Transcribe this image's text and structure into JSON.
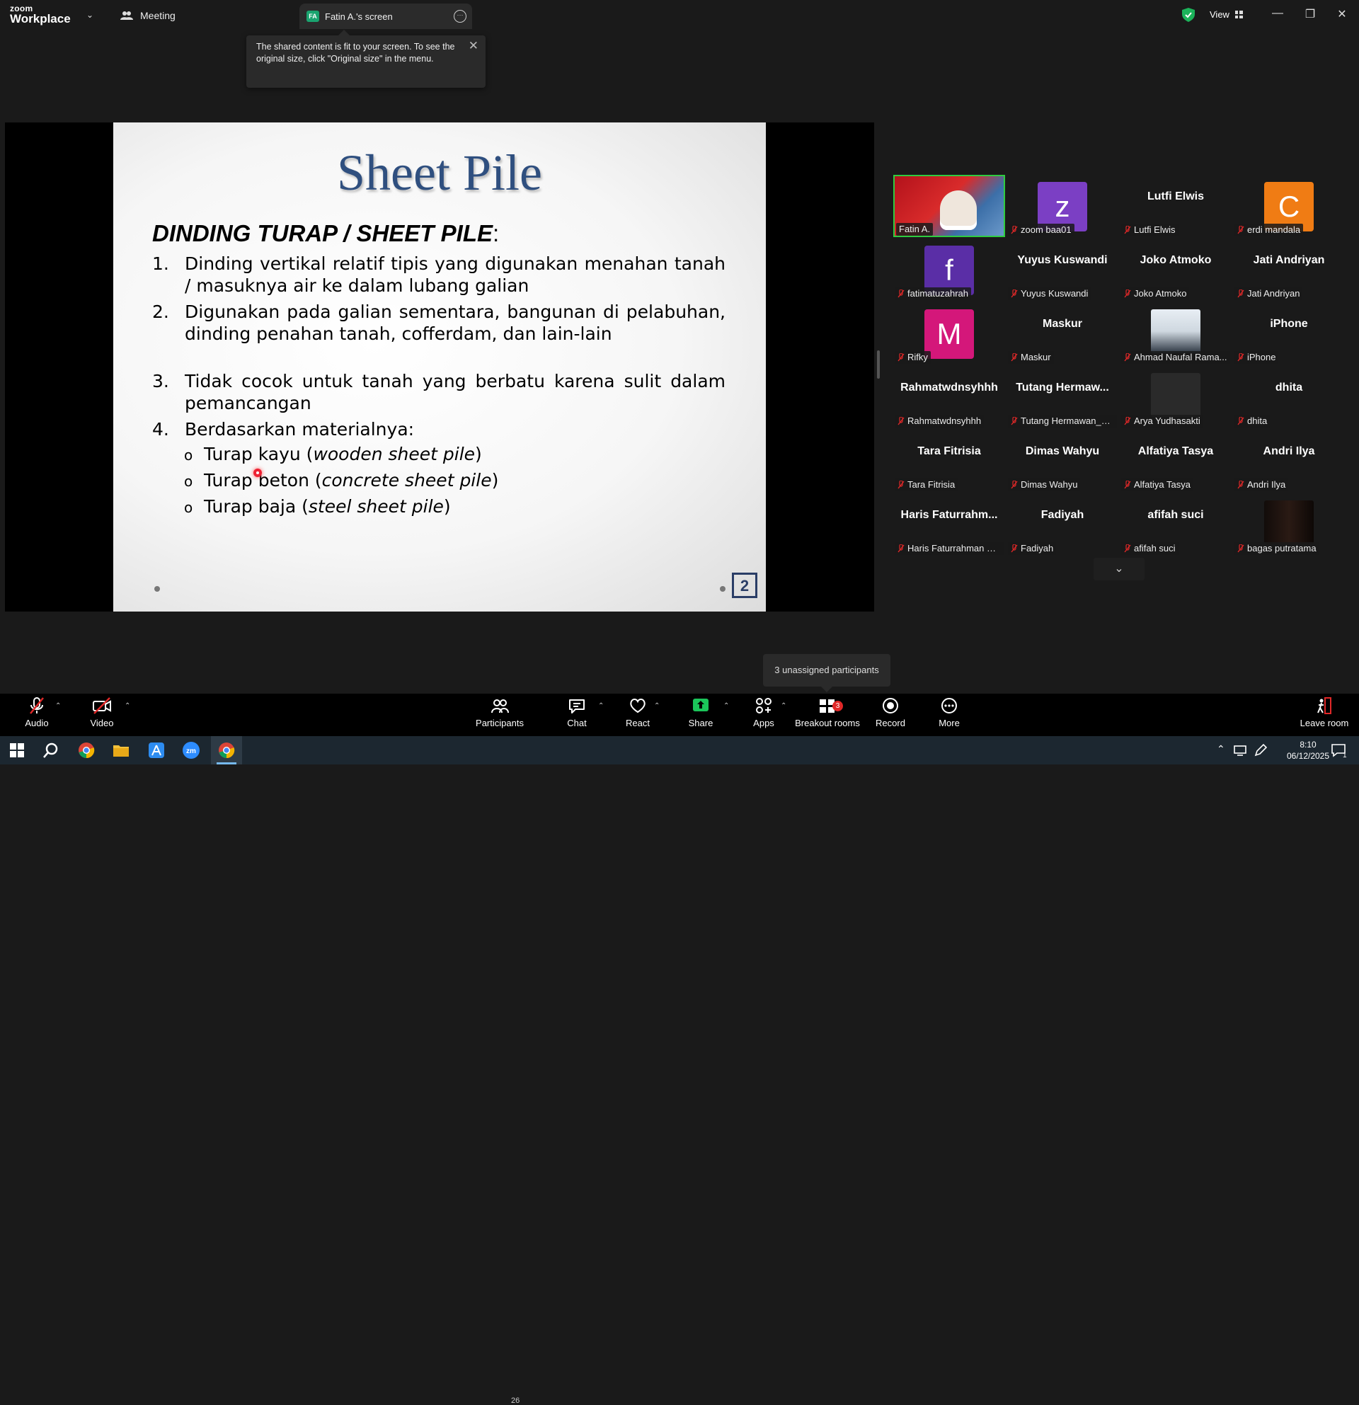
{
  "titlebar": {
    "logo_top": "zoom",
    "logo_bottom": "Workplace",
    "meeting_label": "Meeting",
    "tab_badge": "FA",
    "tab_label": "Fatin A.'s screen",
    "view_label": "View"
  },
  "tooltip": {
    "text": "The shared content is fit to your screen. To see the original size, click \"Original size\" in the menu."
  },
  "slide": {
    "title": "Sheet Pile",
    "heading": "DINDING TURAP / SHEET PILE",
    "heading_colon": ":",
    "points": [
      {
        "num": "1.",
        "text": "Dinding vertikal relatif tipis yang digunakan menahan tanah / masuknya air ke dalam  lubang galian"
      },
      {
        "num": "2.",
        "text": "Digunakan pada galian sementara, bangunan di pelabuhan, dinding penahan tanah, cofferdam, dan lain-lain"
      },
      {
        "num": "3.",
        "text": "Tidak cocok untuk tanah yang berbatu karena sulit dalam pemancangan"
      },
      {
        "num": "4.",
        "text": "Berdasarkan materialnya:"
      }
    ],
    "subpoints": [
      {
        "bullet": "o",
        "text": "Turap kayu (",
        "italic": "wooden sheet pile",
        "end": ")"
      },
      {
        "bullet": "o",
        "text": "Turap beton (",
        "italic": "concrete sheet pile",
        "end": ")"
      },
      {
        "bullet": "o",
        "text": "Turap baja (",
        "italic": "steel sheet pile",
        "end": ")"
      }
    ],
    "page_number": "2"
  },
  "participants": [
    {
      "big": "",
      "name": "Fatin A.",
      "kind": "video"
    },
    {
      "big": "z",
      "name": "zoom baa01",
      "kind": "avatar",
      "color": "#7b3fc4"
    },
    {
      "big": "Lutfi Elwis",
      "name": "Lutfi Elwis",
      "kind": "text"
    },
    {
      "big": "C",
      "name": "erdi mandala",
      "kind": "avatar",
      "color": "#f07c14"
    },
    {
      "big": "f",
      "name": "fatimatuzahrah",
      "kind": "avatar",
      "color": "#5a2ea6"
    },
    {
      "big": "Yuyus Kuswandi",
      "name": "Yuyus Kuswandi",
      "kind": "text"
    },
    {
      "big": "Joko Atmoko",
      "name": "Joko Atmoko",
      "kind": "text"
    },
    {
      "big": "Jati Andriyan",
      "name": "Jati Andriyan",
      "kind": "text"
    },
    {
      "big": "M",
      "name": "Rifky",
      "kind": "avatar",
      "color": "#d4177a"
    },
    {
      "big": "Maskur",
      "name": "Maskur",
      "kind": "text"
    },
    {
      "big": "",
      "name": "Ahmad Naufal Rama...",
      "kind": "photo"
    },
    {
      "big": "iPhone",
      "name": "iPhone",
      "kind": "text"
    },
    {
      "big": "Rahmatwdnsyhhh",
      "name": "Rahmatwdnsyhhh",
      "kind": "text"
    },
    {
      "big": "Tutang  Hermaw...",
      "name": "Tutang Hermawan_TSI",
      "kind": "text"
    },
    {
      "big": "",
      "name": "Arya Yudhasakti",
      "kind": "dark"
    },
    {
      "big": "dhita",
      "name": "dhita",
      "kind": "text"
    },
    {
      "big": "Tara Fitrisia",
      "name": "Tara Fitrisia",
      "kind": "text"
    },
    {
      "big": "Dimas Wahyu",
      "name": "Dimas Wahyu",
      "kind": "text"
    },
    {
      "big": "Alfatiya Tasya",
      "name": "Alfatiya Tasya",
      "kind": "text"
    },
    {
      "big": "Andri Ilya",
      "name": "Andri Ilya",
      "kind": "text"
    },
    {
      "big": "Haris  Faturrahm...",
      "name": "Haris Faturrahman H.P",
      "kind": "text"
    },
    {
      "big": "Fadiyah",
      "name": "Fadiyah",
      "kind": "text"
    },
    {
      "big": "afifah suci",
      "name": "afifah suci",
      "kind": "text"
    },
    {
      "big": "",
      "name": "bagas putratama",
      "kind": "dark2"
    }
  ],
  "unassigned_tooltip": "3 unassigned participants",
  "toolbar": {
    "audio": "Audio",
    "video": "Video",
    "participants": "Participants",
    "participants_count": "26",
    "chat": "Chat",
    "react": "React",
    "share": "Share",
    "apps": "Apps",
    "breakout": "Breakout rooms",
    "breakout_badge": "3",
    "record": "Record",
    "more": "More",
    "leave": "Leave room"
  },
  "taskbar": {
    "time": "8:10",
    "date": "06/12/2025",
    "notification_count": "1"
  },
  "colors": {
    "accent_green": "#1aa36f",
    "active_speaker": "#2ecc40",
    "share_green": "#1bc55a",
    "muted_red": "#e02828"
  }
}
